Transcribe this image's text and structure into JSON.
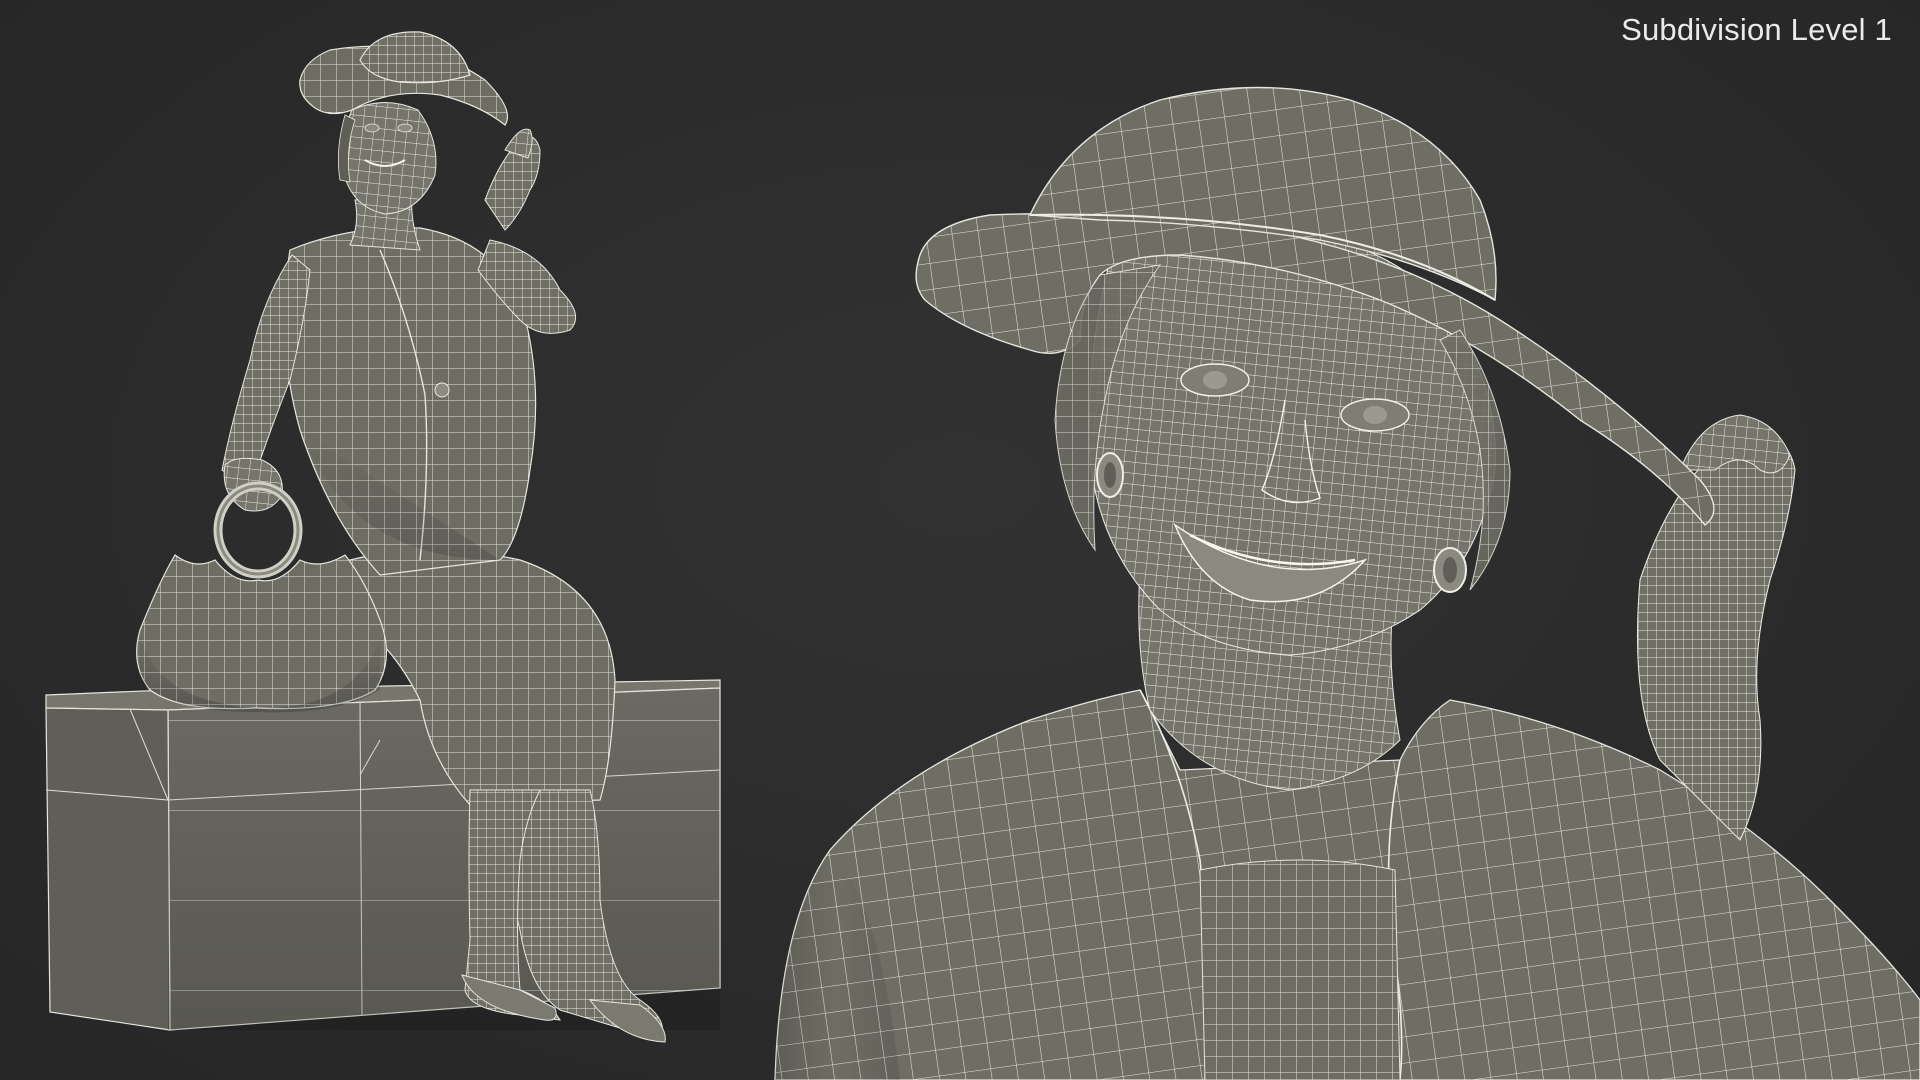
{
  "render": {
    "label": "Subdivision Level 1"
  },
  "colors": {
    "background": "#2c2c2c",
    "mesh_fill": "#6f6f66",
    "mesh_fill_dark": "#55554e",
    "wire": "#e8e8e0",
    "label_text": "#eaeaea"
  },
  "views": [
    {
      "subject": "seated-elderly-woman-full-body",
      "style": "wireframe-over-shaded"
    },
    {
      "subject": "elderly-woman-head-closeup",
      "style": "wireframe-over-shaded"
    }
  ]
}
